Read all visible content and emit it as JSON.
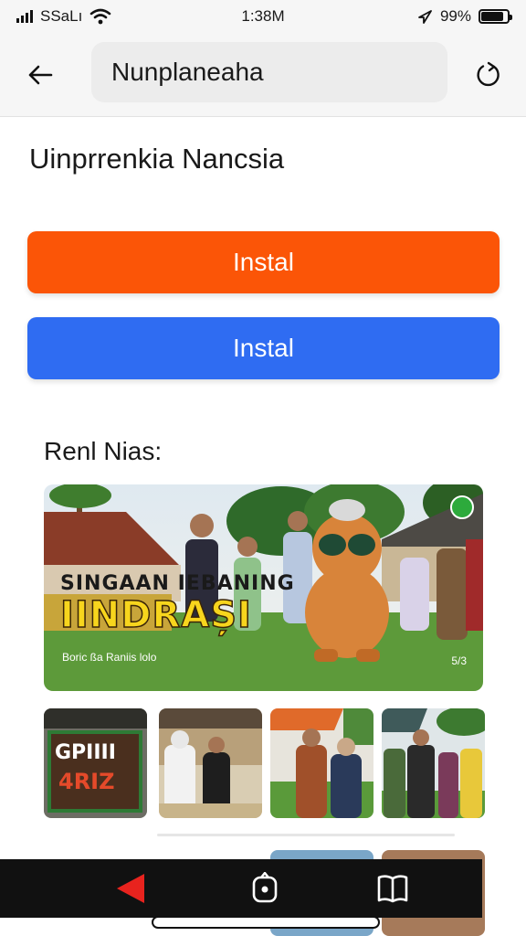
{
  "status_bar": {
    "carrier": "SSaLı",
    "time": "1:38M",
    "battery_text": "99%",
    "battery_level": 0.85
  },
  "top_bar": {
    "search_text": "Nunplaneaha"
  },
  "app_title": "Uinprrenkia Nancsia",
  "buttons": {
    "install_orange": "Instal",
    "install_blue": "Instal"
  },
  "section_title": "Renl Nias:",
  "main_image": {
    "caption_line1": "SINGAAN IEBANING",
    "caption_line2": "IINDRAȘI",
    "caption_small": "Boric ßa Raniis lolo",
    "counter": "5/3"
  },
  "thumbnails": {
    "first_line1": "GPIIII",
    "first_line2": "4RIZ"
  },
  "colors": {
    "orange": "#fb5507",
    "blue": "#2f6cf2"
  }
}
